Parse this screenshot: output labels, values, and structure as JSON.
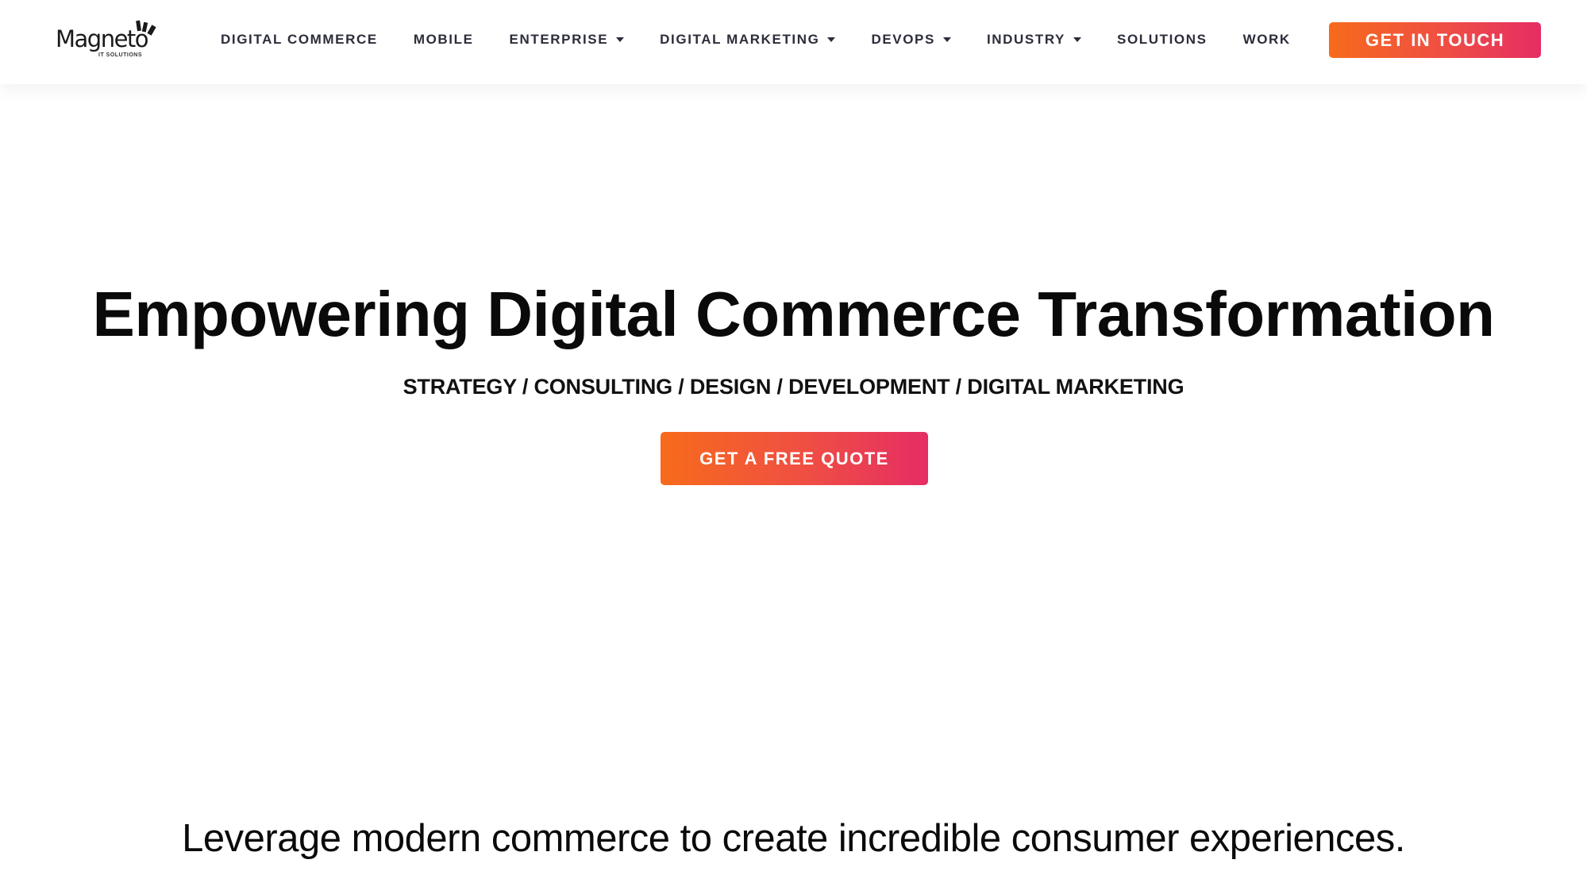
{
  "header": {
    "logo": {
      "name": "Magneto",
      "subtitle": "IT SOLUTIONS"
    },
    "nav": [
      {
        "label": "DIGITAL COMMERCE",
        "has_dropdown": false
      },
      {
        "label": "MOBILE",
        "has_dropdown": false
      },
      {
        "label": "ENTERPRISE",
        "has_dropdown": true
      },
      {
        "label": "DIGITAL MARKETING",
        "has_dropdown": true
      },
      {
        "label": "DEVOPS",
        "has_dropdown": true
      },
      {
        "label": "INDUSTRY",
        "has_dropdown": true
      },
      {
        "label": "SOLUTIONS",
        "has_dropdown": false
      },
      {
        "label": "WORK",
        "has_dropdown": false
      }
    ],
    "cta_label": "GET IN TOUCH"
  },
  "hero": {
    "title": "Empowering Digital Commerce Transformation",
    "subtitle": "STRATEGY / CONSULTING / DESIGN / DEVELOPMENT / DIGITAL MARKETING",
    "cta_label": "GET A FREE QUOTE"
  },
  "section": {
    "tagline": "Leverage modern commerce to create incredible consumer experiences."
  },
  "colors": {
    "accent_start": "#f76b1c",
    "accent_end": "#e52d64",
    "nav_text": "#2b2d3a"
  }
}
